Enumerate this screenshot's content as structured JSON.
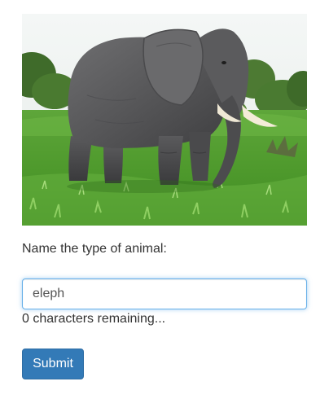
{
  "image": {
    "subject": "elephant-photo"
  },
  "question": {
    "prompt": "Name the type of animal:"
  },
  "answer": {
    "value": "eleph",
    "placeholder": ""
  },
  "counter": {
    "text": "0 characters remaining..."
  },
  "actions": {
    "submit_label": "Submit"
  },
  "colors": {
    "button": "#337ab7",
    "focus_border": "#66afe9",
    "text": "#333333"
  }
}
